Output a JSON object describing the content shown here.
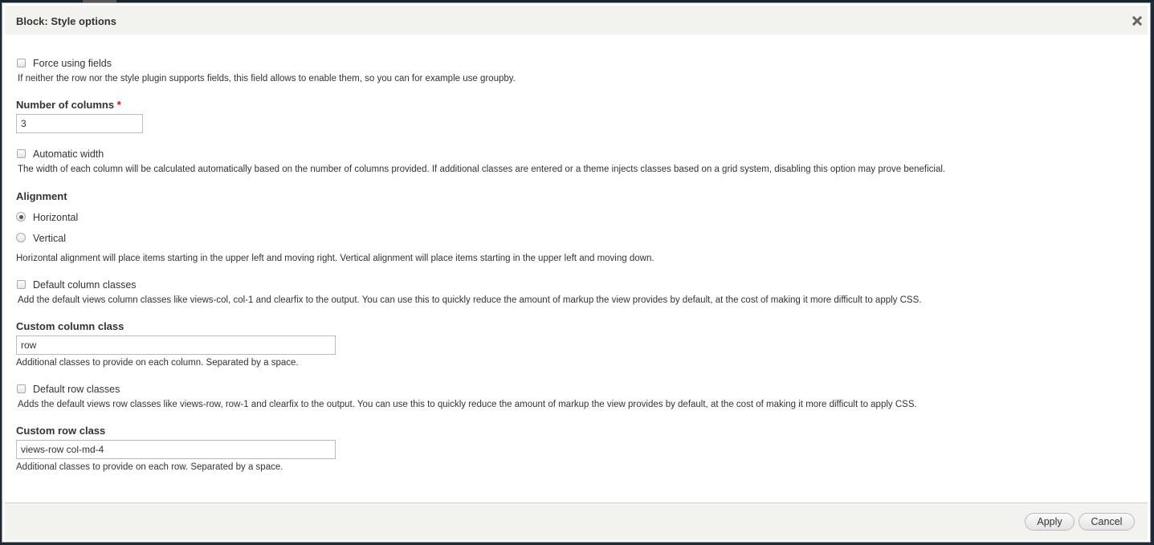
{
  "dialog": {
    "title": "Block: Style options",
    "close_icon": "close-icon"
  },
  "form": {
    "force_fields": {
      "label": "Force using fields",
      "checked": false,
      "description": "If neither the row nor the style plugin supports fields, this field allows to enable them, so you can for example use groupby."
    },
    "columns": {
      "label": "Number of columns",
      "required_marker": "*",
      "value": "3"
    },
    "automatic_width": {
      "label": "Automatic width",
      "checked": false,
      "description": "The width of each column will be calculated automatically based on the number of columns provided. If additional classes are entered or a theme injects classes based on a grid system, disabling this option may prove beneficial."
    },
    "alignment": {
      "label": "Alignment",
      "options": [
        {
          "label": "Horizontal",
          "checked": true
        },
        {
          "label": "Vertical",
          "checked": false
        }
      ],
      "description": "Horizontal alignment will place items starting in the upper left and moving right. Vertical alignment will place items starting in the upper left and moving down."
    },
    "default_column_classes": {
      "label": "Default column classes",
      "checked": false,
      "description": "Add the default views column classes like views-col, col-1 and clearfix to the output. You can use this to quickly reduce the amount of markup the view provides by default, at the cost of making it more difficult to apply CSS."
    },
    "custom_column_class": {
      "label": "Custom column class",
      "value": "row",
      "description": "Additional classes to provide on each column. Separated by a space."
    },
    "default_row_classes": {
      "label": "Default row classes",
      "checked": false,
      "description": "Adds the default views row classes like views-row, row-1 and clearfix to the output. You can use this to quickly reduce the amount of markup the view provides by default, at the cost of making it more difficult to apply CSS."
    },
    "custom_row_class": {
      "label": "Custom row class",
      "value": "views-row col-md-4",
      "description": "Additional classes to provide on each row. Separated by a space."
    }
  },
  "footer": {
    "apply_label": "Apply",
    "cancel_label": "Cancel"
  }
}
